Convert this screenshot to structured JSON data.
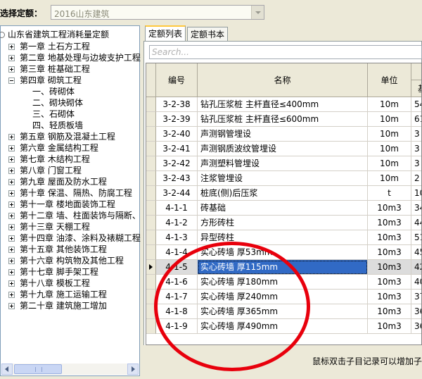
{
  "quota": {
    "label": "选择定额：",
    "value": "2016山东建筑"
  },
  "tree": {
    "root": "山东省建筑工程消耗量定额",
    "items": [
      {
        "label": "第一章 土石方工程",
        "level": 1,
        "state": "collapsed"
      },
      {
        "label": "第二章 地基处理与边坡支护工程",
        "level": 1,
        "state": "collapsed"
      },
      {
        "label": "第三章 桩基础工程",
        "level": 1,
        "state": "collapsed"
      },
      {
        "label": "第四章 砌筑工程",
        "level": 1,
        "state": "expanded"
      },
      {
        "label": "一、砖砌体",
        "level": 2,
        "state": "leaf"
      },
      {
        "label": "二、砌块砌体",
        "level": 2,
        "state": "leaf"
      },
      {
        "label": "三、石砌体",
        "level": 2,
        "state": "leaf"
      },
      {
        "label": "四、轻质板墙",
        "level": 2,
        "state": "leaf"
      },
      {
        "label": "第五章 钢筋及混凝土工程",
        "level": 1,
        "state": "collapsed"
      },
      {
        "label": "第六章 金属结构工程",
        "level": 1,
        "state": "collapsed"
      },
      {
        "label": "第七章 木结构工程",
        "level": 1,
        "state": "collapsed"
      },
      {
        "label": "第八章 门窗工程",
        "level": 1,
        "state": "collapsed"
      },
      {
        "label": "第九章 屋面及防水工程",
        "level": 1,
        "state": "collapsed"
      },
      {
        "label": "第十章 保温、隔热、防腐工程",
        "level": 1,
        "state": "collapsed"
      },
      {
        "label": "第十一章 楼地面装饰工程",
        "level": 1,
        "state": "collapsed"
      },
      {
        "label": "第十二章 墙、柱面装饰与隔断、",
        "level": 1,
        "state": "collapsed"
      },
      {
        "label": "第十三章 天棚工程",
        "level": 1,
        "state": "collapsed"
      },
      {
        "label": "第十四章 油漆、涂料及裱糊工程",
        "level": 1,
        "state": "collapsed"
      },
      {
        "label": "第十五章 其他装饰工程",
        "level": 1,
        "state": "collapsed"
      },
      {
        "label": "第十六章 构筑物及其他工程",
        "level": 1,
        "state": "collapsed"
      },
      {
        "label": "第十七章 脚手架工程",
        "level": 1,
        "state": "collapsed"
      },
      {
        "label": "第十八章 模板工程",
        "level": 1,
        "state": "collapsed"
      },
      {
        "label": "第十九章 施工运输工程",
        "level": 1,
        "state": "collapsed"
      },
      {
        "label": "第二十章 建筑施工增加",
        "level": 1,
        "state": "collapsed"
      }
    ]
  },
  "tabs": [
    {
      "label": "定额列表",
      "active": true
    },
    {
      "label": "定额书本",
      "active": false
    }
  ],
  "search": {
    "placeholder": "Search..."
  },
  "table": {
    "columns": {
      "code": "编号",
      "name": "名称",
      "unit": "单位",
      "extra_fragment": "基"
    },
    "rows": [
      {
        "code": "3-2-38",
        "name": "钻孔压浆桩 主杆直径≤400mm",
        "unit": "10m",
        "extra": "54"
      },
      {
        "code": "3-2-39",
        "name": "钻孔压浆桩 主杆直径≤600mm",
        "unit": "10m",
        "extra": "61"
      },
      {
        "code": "3-2-40",
        "name": "声测钢管埋设",
        "unit": "10m",
        "extra": "3"
      },
      {
        "code": "3-2-41",
        "name": "声测钢质波纹管埋设",
        "unit": "10m",
        "extra": "3"
      },
      {
        "code": "3-2-42",
        "name": "声测塑料管埋设",
        "unit": "10m",
        "extra": "3"
      },
      {
        "code": "3-2-43",
        "name": "注浆管埋设",
        "unit": "10m",
        "extra": "2"
      },
      {
        "code": "3-2-44",
        "name": "桩底(侧)后压浆",
        "unit": "t",
        "extra": "10"
      },
      {
        "code": "4-1-1",
        "name": "砖基础",
        "unit": "10m3",
        "extra": "34"
      },
      {
        "code": "4-1-2",
        "name": "方形砖柱",
        "unit": "10m3",
        "extra": "44"
      },
      {
        "code": "4-1-3",
        "name": "异型砖柱",
        "unit": "10m3",
        "extra": "51"
      },
      {
        "code": "4-1-4",
        "name": "实心砖墙 厚53mm",
        "unit": "10m3",
        "extra": "45"
      },
      {
        "code": "4-1-5",
        "name": "实心砖墙 厚115mm",
        "unit": "10m3",
        "extra": "42",
        "selected": true
      },
      {
        "code": "4-1-6",
        "name": "实心砖墙 厚180mm",
        "unit": "10m3",
        "extra": "40"
      },
      {
        "code": "4-1-7",
        "name": "实心砖墙 厚240mm",
        "unit": "10m3",
        "extra": "37"
      },
      {
        "code": "4-1-8",
        "name": "实心砖墙 厚365mm",
        "unit": "10m3",
        "extra": "36"
      },
      {
        "code": "4-1-9",
        "name": "实心砖墙 厚490mm",
        "unit": "10m3",
        "extra": "36"
      }
    ]
  },
  "status": {
    "text": "鼠标双击子目记录可以增加子"
  },
  "colors": {
    "selection": "#316ac5",
    "annotation": "#e8000c",
    "active_tab": "#ffc83c"
  }
}
